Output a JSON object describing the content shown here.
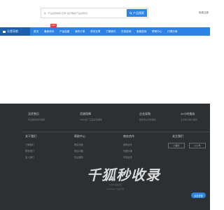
{
  "header": {
    "search_placeholder": "如（产品名称或者“空调”“医疗器械”产品关键词）",
    "search_button": "产品搜索",
    "top_link": "免费注册"
  },
  "nav": {
    "category_label": "分类导航",
    "items": [
      "首页",
      "最新资讯",
      "产品品鉴",
      "我的订单",
      "资讯文章",
      "了解我们",
      "在线咨询",
      "客服咨询",
      "帮助中心",
      "代理分销"
    ],
    "badge": "HOT"
  },
  "footer": {
    "features": [
      {
        "title": "无忧售后",
        "sub": "售后服务我们保障"
      },
      {
        "title": "货源保障",
        "sub": "100%原厂正品货源保障"
      },
      {
        "title": "企业采购",
        "sub": "服务专业高效便捷"
      },
      {
        "title": "24小时服务",
        "sub": "全天候为客户服务"
      }
    ],
    "columns": [
      {
        "head": "关于我们",
        "links": [
          "了解我们",
          "联系我们",
          "加入我们"
        ]
      },
      {
        "head": "帮助中心",
        "links": [
          "购买流程",
          "常见问题",
          "售后服务"
        ]
      },
      {
        "head": "商务合作",
        "links": [
          "采购合作",
          "代理分销",
          "市场合作"
        ]
      }
    ],
    "follow": {
      "head": "关注我们",
      "buttons": [
        "小程序",
        "公众号"
      ]
    },
    "copyright_1": "©2024 版权所有",
    "copyright_2": "Powered by 站点名称"
  },
  "watermark": {
    "text": "千狐秒收录",
    "badge": "点击收录"
  },
  "colors": {
    "nav_blue": "#2b83e7",
    "nav_dark": "#1e5fb2",
    "footer_bg": "#2d3033",
    "badge_red": "#e53935"
  }
}
